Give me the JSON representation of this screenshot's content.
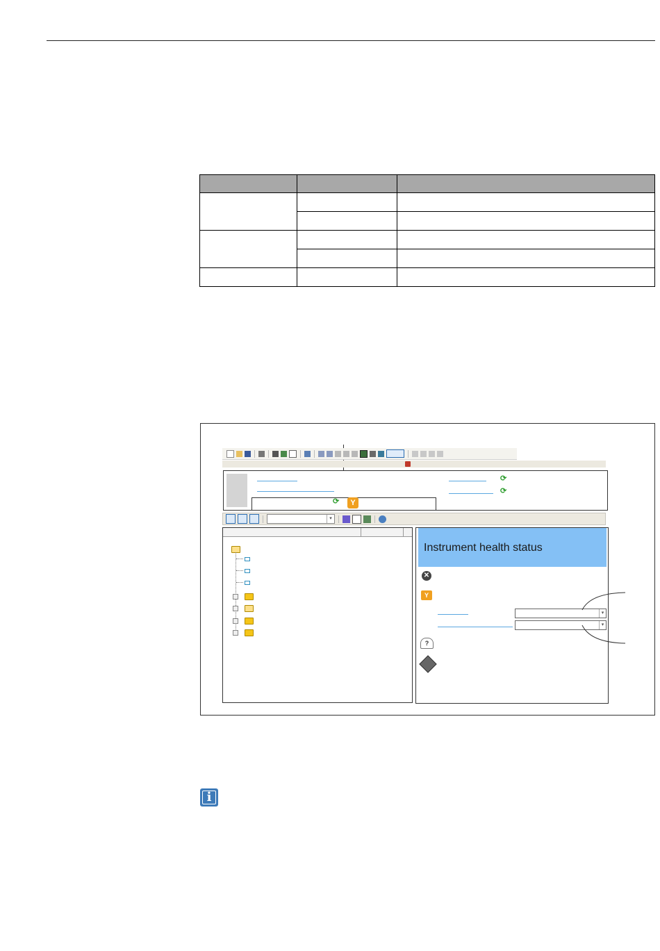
{
  "page": {
    "rule_color": "#222222"
  },
  "table": {
    "header_fill": "#a8a8a8",
    "header": [
      "",
      "",
      ""
    ],
    "rows": [
      [
        "",
        "",
        ""
      ],
      [
        "",
        "",
        ""
      ],
      [
        "",
        "",
        ""
      ],
      [
        "",
        "",
        ""
      ],
      [
        "",
        "",
        ""
      ]
    ]
  },
  "figure": {
    "toolbar_icons": [
      "new-icon",
      "open-icon",
      "save-icon",
      "print-icon",
      "device-icon",
      "connect-icon",
      "help-icon",
      "table-icon",
      "upload-icon",
      "download-icon",
      "edit-icon",
      "online-icon",
      "offline-icon",
      "filter-icon"
    ],
    "health_panel": {
      "title": "Instrument health status",
      "title_fill": "#84c0f5",
      "status_icons": [
        "failure-icon",
        "maintenance-icon",
        "out-of-spec-icon",
        "function-check-icon"
      ]
    },
    "colors": {
      "link": "#5aa7e0",
      "refresh": "#2e9d2e",
      "warning": "#f0a020",
      "info": "#3d7ab8"
    }
  },
  "note": {
    "icon": "info-icon"
  }
}
